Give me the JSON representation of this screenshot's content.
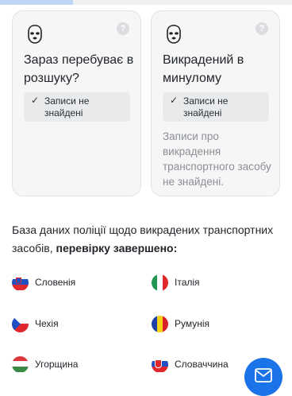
{
  "progress": {
    "fraction": 0.25
  },
  "cards": [
    {
      "title": "Зараз перебуває в розшуку?",
      "badge": "Записи не знайдені",
      "note": "",
      "help": "?",
      "icon": "mask-icon"
    },
    {
      "title": "Викрадений в минулому",
      "badge": "Записи не знайдені",
      "note": "Записи про викрадення транспортного засобу не знайдені.",
      "help": "?",
      "icon": "mask-icon"
    }
  ],
  "summary": {
    "text": "База даних поліції щодо викрадених транспортних засобів, ",
    "bold": "перевірку завершено:"
  },
  "countries": [
    {
      "name": "Словенія",
      "flag": "slovenia-flag"
    },
    {
      "name": "Італія",
      "flag": "italy-flag"
    },
    {
      "name": "Чехія",
      "flag": "czech-flag"
    },
    {
      "name": "Румунія",
      "flag": "romania-flag"
    },
    {
      "name": "Угорщина",
      "flag": "hungary-flag"
    },
    {
      "name": "Словаччина",
      "flag": "slovakia-flag"
    }
  ],
  "fab": {
    "icon": "mail-icon",
    "color": "#1a73e8"
  }
}
